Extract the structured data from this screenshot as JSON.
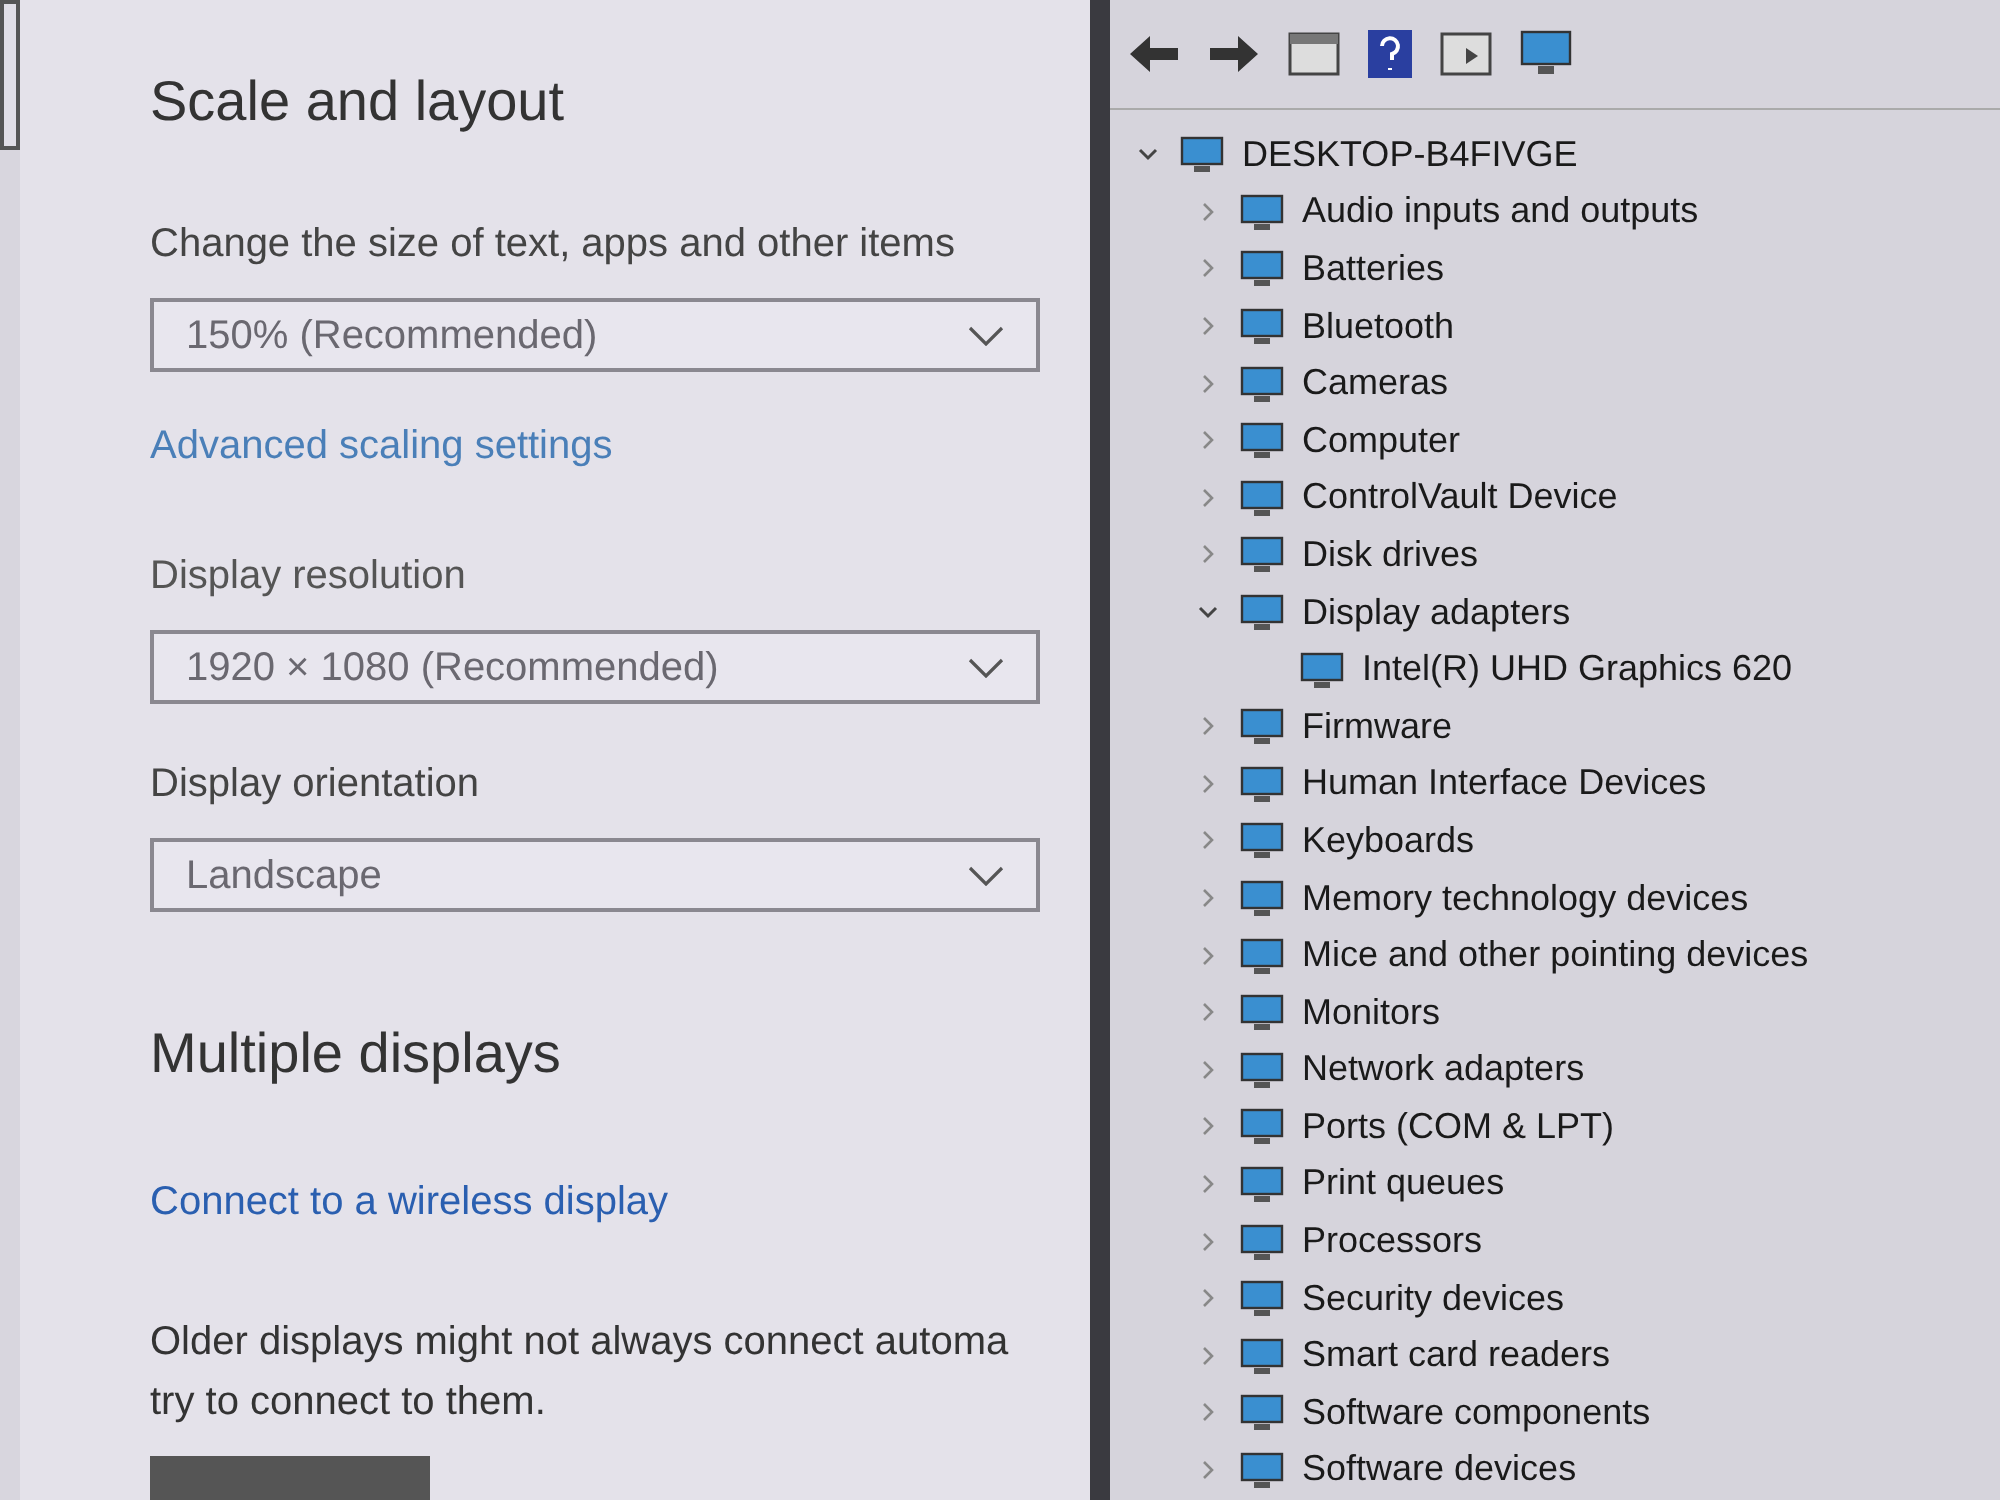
{
  "settings": {
    "scale_heading": "Scale and layout",
    "scale_label": "Change the size of text, apps and other items",
    "scale_value": "150% (Recommended)",
    "advanced_link": "Advanced scaling settings",
    "resolution_label": "Display resolution",
    "resolution_value": "1920 × 1080 (Recommended)",
    "orientation_label": "Display orientation",
    "orientation_value": "Landscape",
    "multiple_heading": "Multiple displays",
    "wireless_link": "Connect to a wireless display",
    "note_lines": [
      "Older displays might not always connect automa",
      "try to connect to them."
    ]
  },
  "device_manager": {
    "root": {
      "label": "DESKTOP-B4FIVGE",
      "expanded": true,
      "children": [
        {
          "label": "Audio inputs and outputs",
          "expanded": false
        },
        {
          "label": "Batteries",
          "expanded": false
        },
        {
          "label": "Bluetooth",
          "expanded": false
        },
        {
          "label": "Cameras",
          "expanded": false
        },
        {
          "label": "Computer",
          "expanded": false
        },
        {
          "label": "ControlVault Device",
          "expanded": false
        },
        {
          "label": "Disk drives",
          "expanded": false
        },
        {
          "label": "Display adapters",
          "expanded": true,
          "children": [
            {
              "label": "Intel(R) UHD Graphics 620"
            }
          ]
        },
        {
          "label": "Firmware",
          "expanded": false
        },
        {
          "label": "Human Interface Devices",
          "expanded": false
        },
        {
          "label": "Keyboards",
          "expanded": false
        },
        {
          "label": "Memory technology devices",
          "expanded": false
        },
        {
          "label": "Mice and other pointing devices",
          "expanded": false
        },
        {
          "label": "Monitors",
          "expanded": false
        },
        {
          "label": "Network adapters",
          "expanded": false
        },
        {
          "label": "Ports (COM & LPT)",
          "expanded": false
        },
        {
          "label": "Print queues",
          "expanded": false
        },
        {
          "label": "Processors",
          "expanded": false
        },
        {
          "label": "Security devices",
          "expanded": false
        },
        {
          "label": "Smart card readers",
          "expanded": false
        },
        {
          "label": "Software components",
          "expanded": false
        },
        {
          "label": "Software devices",
          "expanded": false
        }
      ]
    }
  }
}
